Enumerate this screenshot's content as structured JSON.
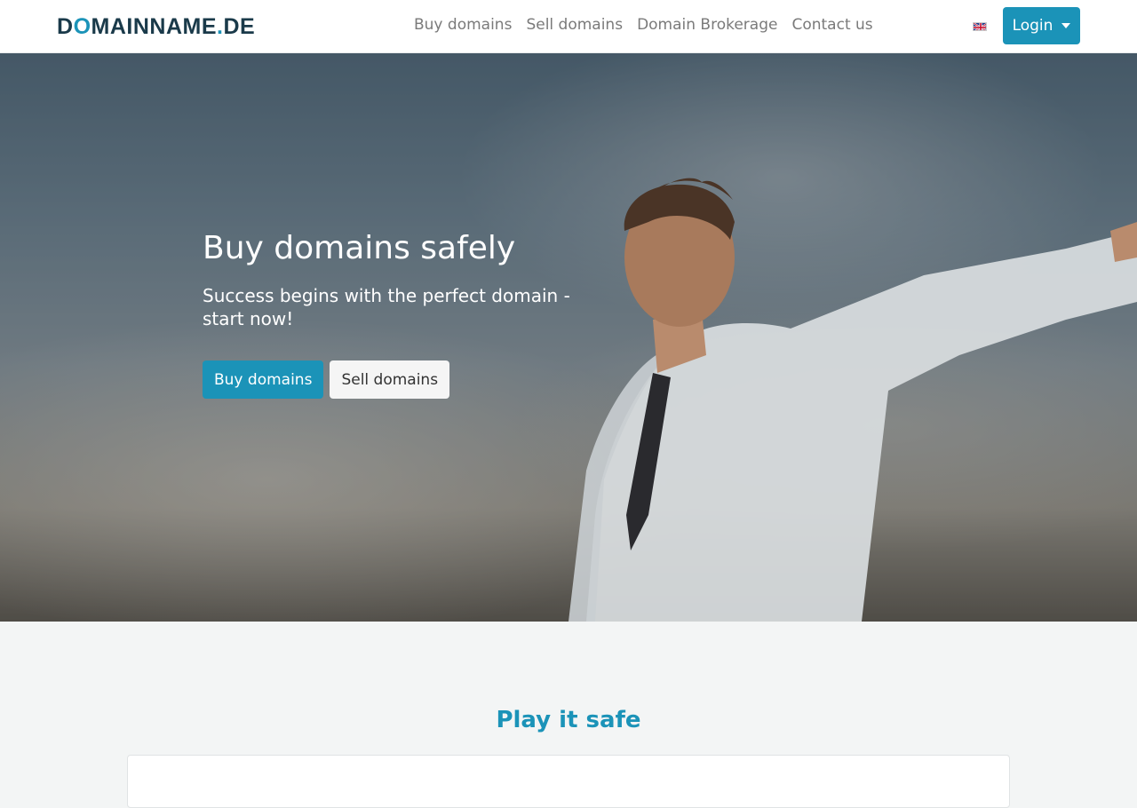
{
  "navbar": {
    "logo": {
      "part1": "D",
      "accent1": "O",
      "part2": "MAINNAME",
      "accent2": ".",
      "part3": "DE"
    },
    "links": [
      {
        "label": "Buy domains"
      },
      {
        "label": "Sell domains"
      },
      {
        "label": "Domain Brokerage"
      },
      {
        "label": "Contact us"
      }
    ],
    "language_icon": "uk-flag-icon",
    "login_label": "Login"
  },
  "hero": {
    "title": "Buy domains safely",
    "subtitle": "Success begins with the perfect domain - start now!",
    "primary_button": "Buy domains",
    "secondary_button": "Sell domains"
  },
  "section": {
    "title": "Play it safe"
  },
  "colors": {
    "accent": "#1b93b8",
    "logo_dark": "#1a3a4a",
    "background": "#f3f5f5"
  }
}
